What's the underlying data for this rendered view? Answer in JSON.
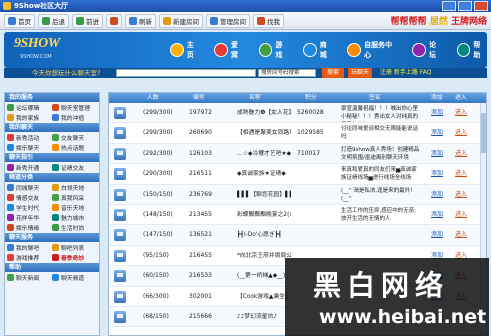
{
  "window": {
    "title": "9Show社区大厅"
  },
  "toolbar": {
    "items": [
      {
        "label": "首页",
        "color": "#3a7bd5"
      },
      {
        "label": "后退",
        "color": "#3a9b45"
      },
      {
        "label": "前进",
        "color": "#3a9b45"
      },
      {
        "label": "",
        "color": "#d04a1f"
      },
      {
        "label": "刷新",
        "color": "#3a7bd5"
      },
      {
        "label": "新建房间",
        "color": "#e09a12"
      },
      {
        "label": "管理房间",
        "color": "#3a7bd5"
      },
      {
        "label": "找我",
        "color": "#d04a1f"
      }
    ],
    "promo": [
      "帮帮帮帮",
      "居然",
      "王牌网络"
    ]
  },
  "banner": {
    "logo": "9SHOW",
    "logo_sub": "9SHOW.COM",
    "nav": [
      {
        "label": "主页",
        "color": "#ffb300"
      },
      {
        "label": "爱窝",
        "color": "#e53935"
      },
      {
        "label": "游戏",
        "color": "#43a047"
      },
      {
        "label": "商城",
        "color": "#1e88e5"
      },
      {
        "label": "自服务中心",
        "color": "#fb8c00"
      },
      {
        "label": "论坛",
        "color": "#8e24aa"
      },
      {
        "label": "帮助",
        "color": "#00897b"
      }
    ]
  },
  "search": {
    "prompt": "今天你想玩什么聊天室?",
    "select_value": "搜房间号码搜索",
    "btn_search": "搜索",
    "btn_random": "玩聊天",
    "links": "注册  新手上路  FAQ"
  },
  "sidebar": {
    "sections": [
      {
        "title": "我的服务",
        "items": [
          {
            "label": "论坛哪辑",
            "color": "#3a9b45"
          },
          {
            "label": "聊天室管理",
            "color": "#d04a1f"
          },
          {
            "label": "我的家族",
            "color": "#e09a12"
          },
          {
            "label": "我的冲值",
            "color": "#3a7bd5"
          }
        ]
      },
      {
        "title": "我的聊天",
        "items": [
          {
            "label": "新秀活动",
            "color": "#e53935"
          },
          {
            "label": "交友聊天",
            "color": "#43a047"
          },
          {
            "label": "娱乐聊天",
            "color": "#1e88e5"
          },
          {
            "label": "热点话题",
            "color": "#fb8c00"
          }
        ]
      },
      {
        "title": "聊天指引",
        "items": [
          {
            "label": "新秀开通",
            "color": "#8e24aa"
          },
          {
            "label": "证绩交友",
            "color": "#00897b"
          }
        ]
      },
      {
        "title": "频道分类",
        "items": [
          {
            "label": "同城聊天",
            "color": "#3a7bd5"
          },
          {
            "label": "白领天地",
            "color": "#e09a12"
          },
          {
            "label": "情感交友",
            "color": "#e53935"
          },
          {
            "label": "真我风采",
            "color": "#43a047"
          },
          {
            "label": "学生时代",
            "color": "#1e88e5"
          },
          {
            "label": "音乐天地",
            "color": "#fb8c00"
          },
          {
            "label": "花样年华",
            "color": "#8e24aa"
          },
          {
            "label": "魅力城市",
            "color": "#00897b"
          },
          {
            "label": "娱乐情缘",
            "color": "#d04a1f"
          },
          {
            "label": "生活时尚",
            "color": "#3a9b45"
          }
        ]
      },
      {
        "title": "聊天服务",
        "items": [
          {
            "label": "我的聊吧",
            "color": "#3a7bd5"
          },
          {
            "label": "聊吧列表",
            "color": "#e09a12"
          },
          {
            "label": "游戏推荐",
            "color": "#e53935"
          },
          {
            "label": "春季奇妙",
            "color": "#d11c1c",
            "hot": true
          }
        ]
      },
      {
        "title": "帮助",
        "items": [
          {
            "label": "聊天新闻",
            "color": "#43a047"
          },
          {
            "label": "聊天频道",
            "color": "#1e88e5"
          }
        ]
      }
    ]
  },
  "table": {
    "headers": [
      "人数",
      "编号",
      "名称",
      "积分",
      "签名",
      "添加",
      "进入"
    ],
    "rows": [
      {
        "members": "(299/300)",
        "id": "197972",
        "name": "成熟魅力❹【女人花】",
        "score": "5260028",
        "sig": "豪宣温馨祝福！！！喊出你心里小秘秘！！！秀出女人对纯真的风采！！！",
        "add": "添加",
        "enter": "进入"
      },
      {
        "members": "(299/300)",
        "id": "260690",
        "name": "【相遇是聚美女同路坊】",
        "score": "1029585",
        "sig": "讨论同味爱谈相交无限能能说话吗",
        "add": "添加",
        "enter": "进入"
      },
      {
        "members": "(292/300)",
        "id": "126103",
        "name": "…☆◆冷攫才艺吧★◆…",
        "score": "710017",
        "sig": "打造9show真人秀场！创建精品文明氛围/墨迪离别聊天环境☆☆☆",
        "add": "添加",
        "enter": "进入"
      },
      {
        "members": "(290/300)",
        "id": "216511",
        "name": "◆真诚家族★证绩◆",
        "score": "",
        "sig": "来真和爱真的同友们来▅真诚家族证绩线场▅进行线场全线场",
        "add": "添加",
        "enter": "进入"
      },
      {
        "members": "(150/150)",
        "id": "236769",
        "name": "▌▌▌【聊您花园】▌▌▌",
        "score": "",
        "sig": "(__'' 渴是私浓,逢是来的最外！(__'' ",
        "add": "添加",
        "enter": "进入"
      },
      {
        "members": "(148/150)",
        "id": "213455",
        "name": "彩蝶飘飘飘晚宴之2(☺)",
        "score": "",
        "sig": "生活工作的压抑,感应中的无奈;放开生活的无情的人",
        "add": "添加",
        "enter": "进入"
      },
      {
        "members": "(147/150)",
        "id": "136521",
        "name": "┣┫I-Do'心愿ぎ┣┫",
        "score": "",
        "sig": "",
        "add": "添加",
        "enter": "进入"
      },
      {
        "members": "(95/150)",
        "id": "216455",
        "name": "*向北京王府井周局公",
        "score": "",
        "sig": "",
        "add": "添加",
        "enter": "进入"
      },
      {
        "members": "(60/150)",
        "id": "216533",
        "name": "(__第一桥梯▲◆__)",
        "score": "",
        "sig": "",
        "add": "添加",
        "enter": "进入"
      },
      {
        "members": "(66/300)",
        "id": "302001",
        "name": "【Cook游戏▲乘坐】",
        "score": "",
        "sig": "",
        "add": "添加",
        "enter": "进入"
      },
      {
        "members": "(68/150)",
        "id": "215666",
        "name": "♪♪梦幻流星坊♪",
        "score": "",
        "sig": "",
        "add": "添加",
        "enter": "进入"
      }
    ]
  },
  "watermark": {
    "cn": "黑白网络",
    "url": "www.heibai.net"
  }
}
